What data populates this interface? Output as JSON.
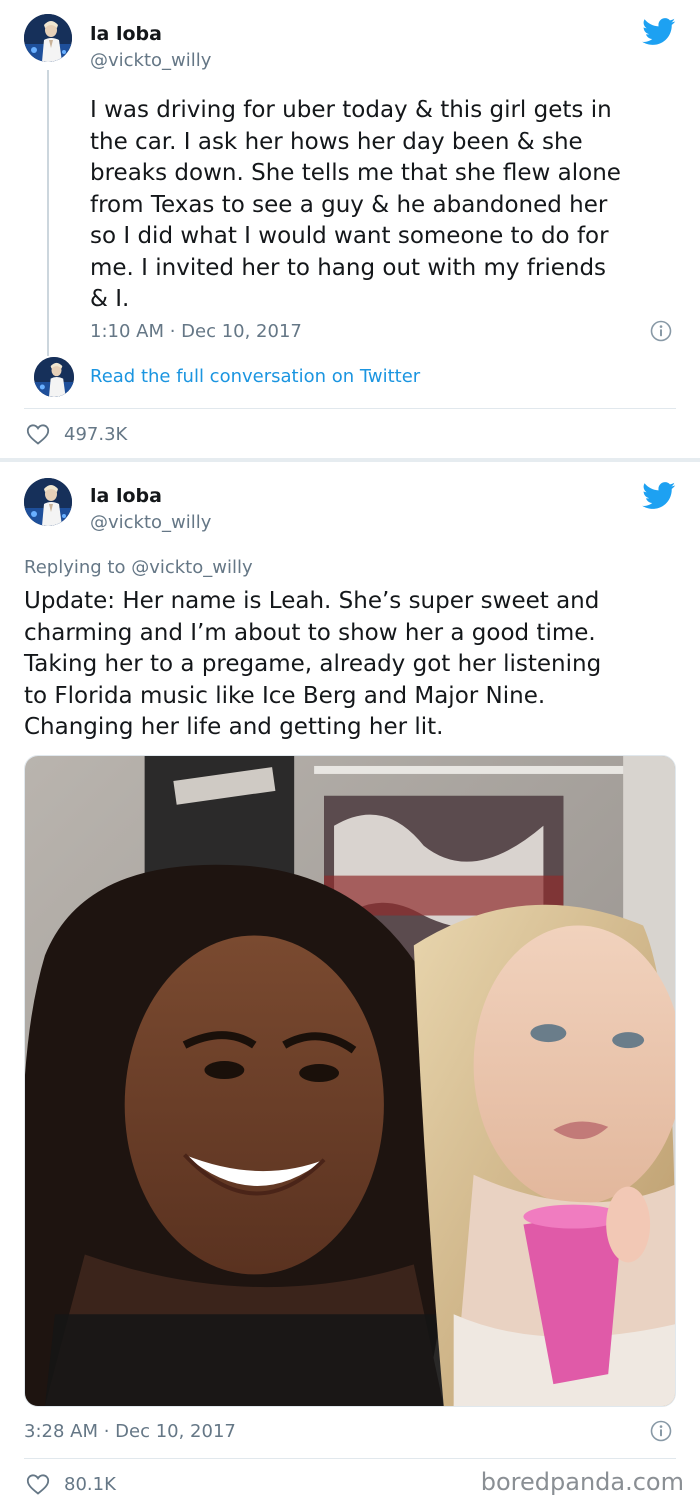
{
  "tweets": [
    {
      "display_name": "la loba",
      "handle": "@vickto_willy",
      "text": "I was driving for uber today & this girl gets in\nthe car. I ask her hows her day been & she\nbreaks down. She tells me that she flew alone\nfrom Texas to see a guy & he abandoned her\nso I did what I would want someone to do for\nme. I invited her to hang out with my friends\n& I.",
      "timestamp": "1:10 AM · Dec 10, 2017",
      "conversation_link": "Read the full conversation on Twitter",
      "likes": "497.3K"
    },
    {
      "display_name": "la loba",
      "handle": "@vickto_willy",
      "replying_to": "Replying to @vickto_willy",
      "text": "Update: Her name is Leah. She’s super sweet and\ncharming and I’m about to show her a good time.\nTaking her to a pregame, already got her listening\nto Florida music like Ice Berg and Major Nine.\nChanging her life and getting her lit.",
      "timestamp": "3:28 AM · Dec 10, 2017",
      "likes": "80.1K"
    }
  ],
  "watermark": "boredpanda.com",
  "icons": {
    "brand": "twitter-bird-icon",
    "info": "info-icon",
    "like": "heart-icon"
  },
  "colors": {
    "twitter_blue": "#1da1f2",
    "link_blue": "#1b95e0",
    "secondary_text": "#657786",
    "primary_text": "#14171a",
    "divider": "#e6ecf0"
  }
}
